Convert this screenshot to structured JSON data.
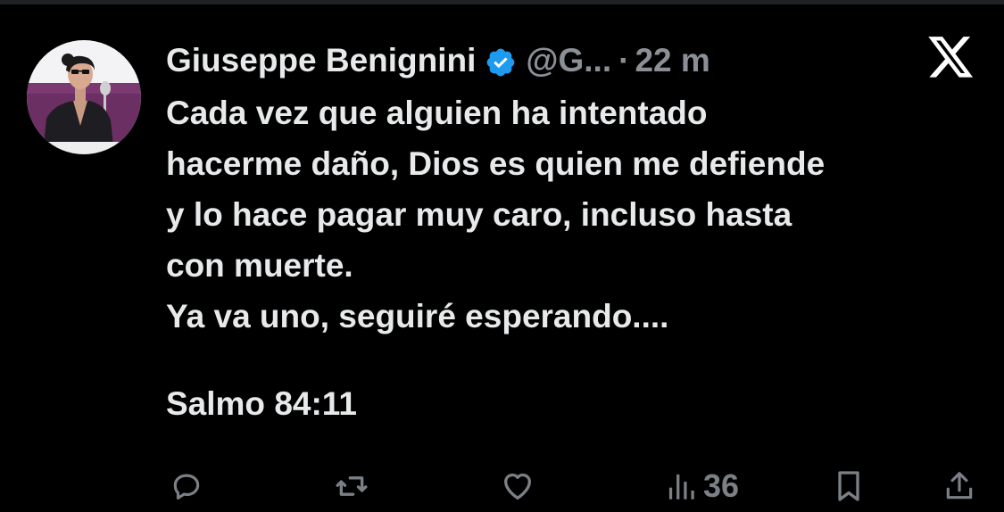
{
  "tweet": {
    "author": {
      "display_name": "Giuseppe Benignini",
      "handle": "@G...",
      "verified": true,
      "avatar_icon": "profile-photo"
    },
    "separator": "·",
    "time": "22 m",
    "platform_icon": "x-logo-icon",
    "body_lines": [
      "Cada vez que alguien ha intentado",
      "hacerme daño, Dios es quien me defiende",
      "y lo hace pagar muy caro, incluso hasta",
      "con muerte.",
      "Ya va uno, seguiré esperando....",
      "Salmo 84:11"
    ],
    "actions": {
      "reply_icon": "reply-icon",
      "retweet_icon": "retweet-icon",
      "like_icon": "heart-icon",
      "views_icon": "views-icon",
      "views_count": "36",
      "bookmark_icon": "bookmark-icon",
      "share_icon": "share-icon"
    }
  },
  "colors": {
    "background": "#000000",
    "text": "#e7e9ea",
    "secondary": "#8b9096",
    "verified": "#1d9bf0"
  }
}
